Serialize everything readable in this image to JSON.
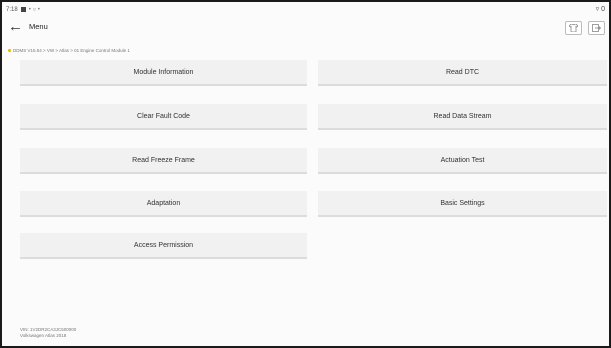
{
  "status_bar": {
    "time": "7:18",
    "icons_text": "• ○ •",
    "right": "▿ 0"
  },
  "header": {
    "back_icon": "arrow-left-icon",
    "title": "Menu",
    "btn1_icon": "shirt-icon",
    "btn2_icon": "exit-icon"
  },
  "breadcrumb": "DDMS V15.54 > VW > Atlas > 01 Engine Control Module 1",
  "menu": {
    "module_information": "Module Information",
    "read_dtc": "Read DTC",
    "clear_fault_code": "Clear Fault Code",
    "read_data_stream": "Read Data Stream",
    "read_freeze_frame": "Read Freeze Frame",
    "actuation_test": "Actuation Test",
    "adaptation": "Adaptation",
    "basic_settings": "Basic Settings",
    "access_permission": "Access Permission"
  },
  "footer": {
    "vin": "VIN: 1V2DR2CA3JC500000",
    "vehicle": "Volkswagen Atlas 2018"
  }
}
